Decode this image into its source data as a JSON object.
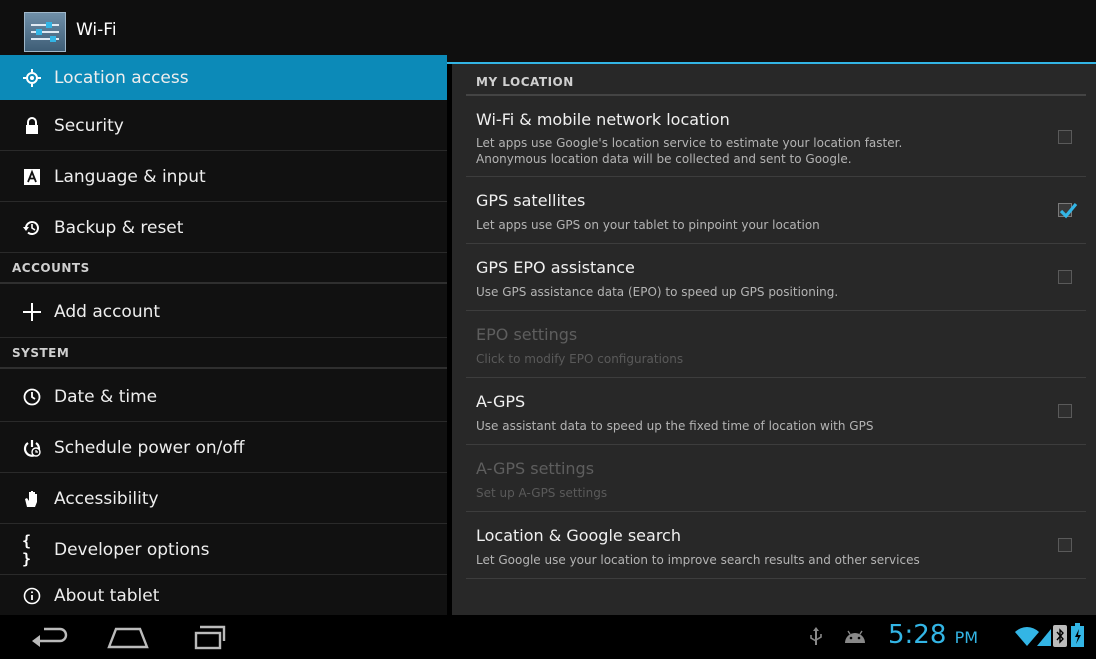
{
  "header": {
    "title": "Wi-Fi"
  },
  "sidebar": {
    "items": [
      {
        "label": "Location access",
        "icon": "location-icon"
      },
      {
        "label": "Security",
        "icon": "lock-icon"
      },
      {
        "label": "Language & input",
        "icon": "keyboard-icon"
      },
      {
        "label": "Backup & reset",
        "icon": "backup-icon"
      }
    ],
    "accounts_header": "ACCOUNTS",
    "accounts": [
      {
        "label": "Add account",
        "icon": "plus-icon"
      }
    ],
    "system_header": "SYSTEM",
    "system": [
      {
        "label": "Date & time",
        "icon": "clock-icon"
      },
      {
        "label": "Schedule power on/off",
        "icon": "power-schedule-icon"
      },
      {
        "label": "Accessibility",
        "icon": "hand-icon"
      },
      {
        "label": "Developer options",
        "icon": "braces-icon"
      },
      {
        "label": "About tablet",
        "icon": "info-icon"
      }
    ]
  },
  "main": {
    "section_header": "MY LOCATION",
    "prefs": [
      {
        "title": "Wi-Fi & mobile network location",
        "summary1": "Let apps use Google's location service to estimate your location faster.",
        "summary2": "Anonymous location data will be collected and sent to Google.",
        "checked": false,
        "enabled": true
      },
      {
        "title": "GPS satellites",
        "summary1": "Let apps use GPS on your tablet to pinpoint your location",
        "checked": true,
        "enabled": true
      },
      {
        "title": "GPS EPO assistance",
        "summary1": "Use GPS assistance data (EPO) to speed up GPS positioning.",
        "checked": false,
        "enabled": true
      },
      {
        "title": "EPO settings",
        "summary1": "Click to modify EPO configurations",
        "enabled": false
      },
      {
        "title": "A-GPS",
        "summary1": "Use assistant data to speed up the fixed time of location with GPS",
        "checked": false,
        "enabled": true
      },
      {
        "title": "A-GPS settings",
        "summary1": "Set up A-GPS settings",
        "enabled": false
      },
      {
        "title": "Location & Google search",
        "summary1": "Let Google use your location to improve search results and other services",
        "checked": false,
        "enabled": true
      }
    ]
  },
  "status": {
    "time": "5:28",
    "ampm": "PM"
  },
  "colors": {
    "accent": "#33b5e5",
    "selected": "#0c8ab8"
  }
}
